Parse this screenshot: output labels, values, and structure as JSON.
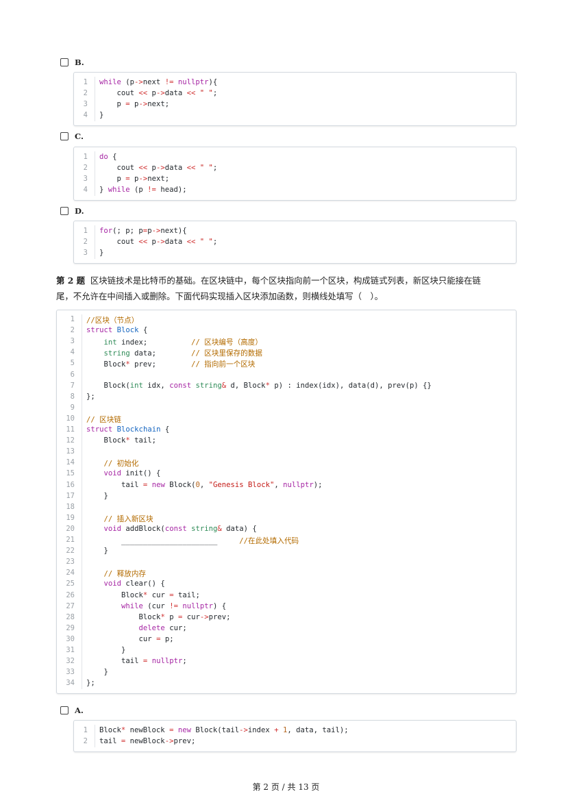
{
  "options_top": [
    {
      "label": "B.",
      "lines": [
        "while (p->next != nullptr){",
        "    cout << p->data << \" \";",
        "    p = p->next;",
        "}"
      ]
    },
    {
      "label": "C.",
      "lines": [
        "do {",
        "    cout << p->data << \" \";",
        "    p = p->next;",
        "} while (p != head);"
      ]
    },
    {
      "label": "D.",
      "lines": [
        "for(; p; p=p->next){",
        "    cout << p->data << \" \";",
        "}"
      ]
    }
  ],
  "question": {
    "number": "第 2 题",
    "text_line1": "区块链技术是比特币的基础。在区块链中，每个区块指向前一个区块，构成链式列表，新区块只能接在链",
    "text_line2": "尾，不允许在中间插入或删除。下面代码实现插入区块添加函数，则横线处填写（　）。"
  },
  "main_code": [
    "//区块（节点）",
    "struct Block {",
    "    int index;          // 区块编号（高度）",
    "    string data;        // 区块里保存的数据",
    "    Block* prev;        // 指向前一个区块",
    "",
    "    Block(int idx, const string& d, Block* p) : index(idx), data(d), prev(p) {}",
    "};",
    "",
    "// 区块链",
    "struct Blockchain {",
    "    Block* tail;",
    "",
    "    // 初始化",
    "    void init() {",
    "        tail = new Block(0, \"Genesis Block\", nullptr);",
    "    }",
    "",
    "    // 插入新区块",
    "    void addBlock(const string& data) {",
    "        ______________________     //在此处填入代码",
    "    }",
    "",
    "    // 释放内存",
    "    void clear() {",
    "        Block* cur = tail;",
    "        while (cur != nullptr) {",
    "            Block* p = cur->prev;",
    "            delete cur;",
    "            cur = p;",
    "        }",
    "        tail = nullptr;",
    "    }",
    "};"
  ],
  "option_a": {
    "label": "A.",
    "lines": [
      "Block* newBlock = new Block(tail->index + 1, data, tail);",
      "tail = newBlock->prev;"
    ]
  },
  "footer": "第 2 页 / 共 13 页"
}
